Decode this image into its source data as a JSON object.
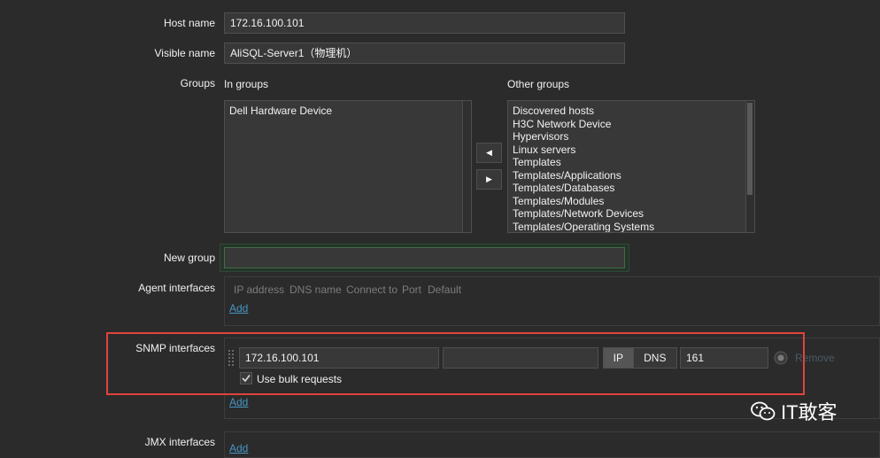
{
  "form": {
    "host_name_label": "Host name",
    "host_name_value": "172.16.100.101",
    "visible_name_label": "Visible name",
    "visible_name_value": "AliSQL-Server1（物理机）",
    "groups_label": "Groups",
    "in_groups_label": "In groups",
    "other_groups_label": "Other groups",
    "in_groups": [
      "Dell Hardware Device"
    ],
    "other_groups": [
      "Discovered hosts",
      "H3C Network Device",
      "Hypervisors",
      "Linux servers",
      "Templates",
      "Templates/Applications",
      "Templates/Databases",
      "Templates/Modules",
      "Templates/Network Devices",
      "Templates/Operating Systems"
    ],
    "move_left_glyph": "◀",
    "move_right_glyph": "▶",
    "new_group_label": "New group",
    "new_group_value": ""
  },
  "agent": {
    "label": "Agent interfaces",
    "columns": [
      "IP address",
      "DNS name",
      "Connect to",
      "Port",
      "Default"
    ],
    "add_label": "Add"
  },
  "snmp": {
    "label": "SNMP interfaces",
    "ip_value": "172.16.100.101",
    "dns_value": "",
    "connect_ip": "IP",
    "connect_dns": "DNS",
    "port_value": "161",
    "remove_label": "Remove",
    "bulk_label": "Use bulk requests",
    "bulk_checked": true,
    "add_label": "Add"
  },
  "jmx": {
    "label": "JMX interfaces",
    "add_label": "Add"
  },
  "watermark": {
    "text": "IT敢客"
  },
  "colors": {
    "background": "#2b2b2b",
    "input_bg": "#383838",
    "link": "#4796c4",
    "highlight": "#e0433c"
  }
}
